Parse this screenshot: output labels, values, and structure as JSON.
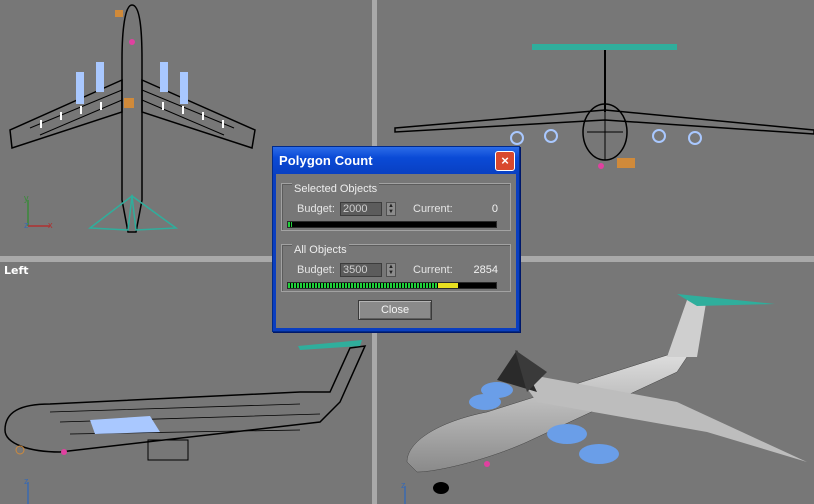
{
  "viewports": {
    "top": {
      "label": ""
    },
    "front": {
      "label": ""
    },
    "left": {
      "label": "Left"
    },
    "perspective": {
      "label": ""
    }
  },
  "dialog": {
    "title": "Polygon Count",
    "close_icon": "×",
    "selected": {
      "group_title": "Selected Objects",
      "budget_label": "Budget:",
      "budget_value": "2000",
      "current_label": "Current:",
      "current_value": "0",
      "fill_fraction": 0.02
    },
    "all": {
      "group_title": "All Objects",
      "budget_label": "Budget:",
      "budget_value": "3500",
      "current_label": "Current:",
      "current_value": "2854",
      "fill_fraction": 0.8154
    },
    "close_label": "Close"
  },
  "colors": {
    "viewport_bg": "#777777",
    "wireframe": "#000000",
    "engine_highlight": "#a9c8ff",
    "tail_teal": "#2fae9c",
    "bar_green": "#1fd13a",
    "bar_yellow": "#e8e020",
    "titlebar": "#0a4ad6"
  }
}
